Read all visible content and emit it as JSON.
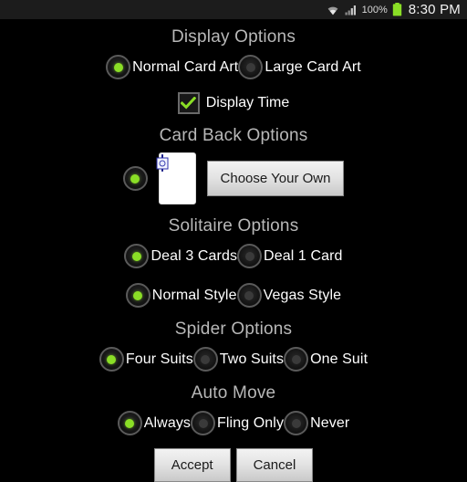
{
  "statusbar": {
    "wifi_icon": "wifi-icon",
    "signal_icon": "cellular-signal-icon",
    "battery_percent": "100%",
    "battery_icon": "battery-full-icon",
    "clock": "8:30 PM",
    "background_color": "#1c1c1c"
  },
  "theme": {
    "background": "#000000",
    "accent_green": "#8ade26",
    "section_title_color": "#b8b8b8",
    "label_color": "#ffffff",
    "button_face": "#e2e2e2"
  },
  "sections": [
    {
      "title": "Display Options",
      "rows": [
        {
          "type": "radio-group",
          "options": [
            {
              "label": "Normal Card Art",
              "checked": true
            },
            {
              "label": "Large Card Art",
              "checked": false
            }
          ]
        },
        {
          "type": "checkbox",
          "label": "Display Time",
          "checked": true
        }
      ]
    },
    {
      "title": "Card Back Options",
      "rows": [
        {
          "type": "cardback",
          "radio_checked": true,
          "card_image_name": "blue-card-back",
          "button_label": "Choose Your Own"
        }
      ]
    },
    {
      "title": "Solitaire Options",
      "rows": [
        {
          "type": "radio-group",
          "options": [
            {
              "label": "Deal 3 Cards",
              "checked": true
            },
            {
              "label": "Deal 1 Card",
              "checked": false
            }
          ]
        },
        {
          "type": "radio-group",
          "options": [
            {
              "label": "Normal Style",
              "checked": true
            },
            {
              "label": "Vegas Style",
              "checked": false
            }
          ]
        }
      ]
    },
    {
      "title": "Spider Options",
      "rows": [
        {
          "type": "radio-group",
          "options": [
            {
              "label": "Four Suits",
              "checked": true
            },
            {
              "label": "Two Suits",
              "checked": false
            },
            {
              "label": "One Suit",
              "checked": false
            }
          ]
        }
      ]
    },
    {
      "title": "Auto Move",
      "rows": [
        {
          "type": "radio-group",
          "options": [
            {
              "label": "Always",
              "checked": true
            },
            {
              "label": "Fling Only",
              "checked": false
            },
            {
              "label": "Never",
              "checked": false
            }
          ]
        }
      ]
    }
  ],
  "footer": {
    "accept_label": "Accept",
    "cancel_label": "Cancel"
  }
}
